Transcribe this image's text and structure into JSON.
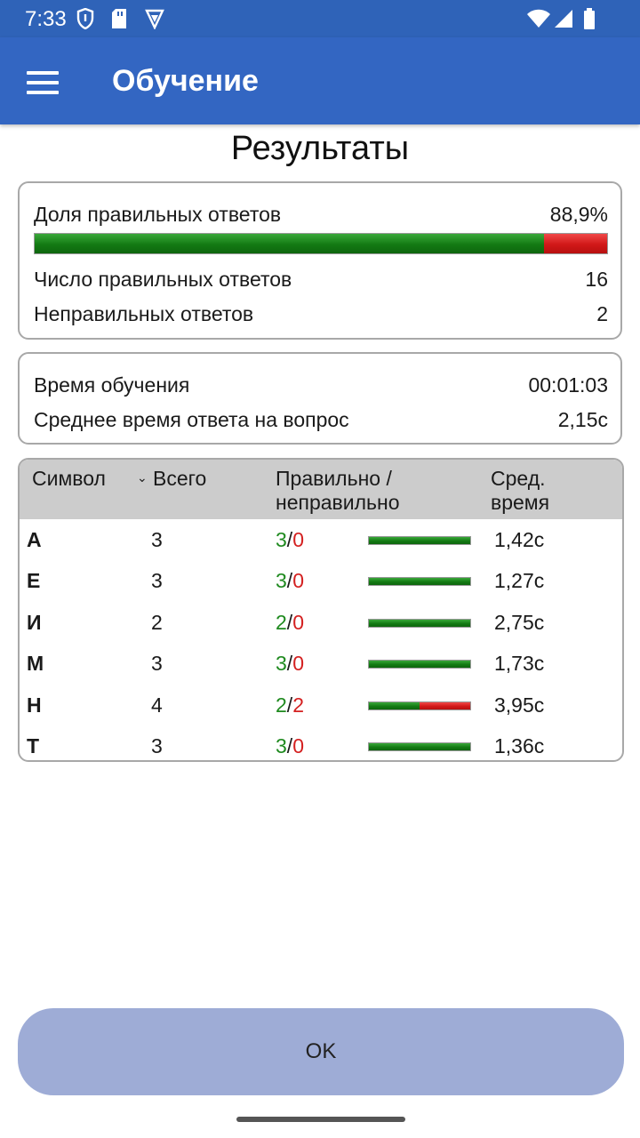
{
  "status": {
    "time": "7:33"
  },
  "app": {
    "title": "Обучение"
  },
  "page": {
    "title": "Результаты"
  },
  "summary": {
    "share_label": "Доля правильных ответов",
    "share_value": "88,9%",
    "share_fraction": 0.889,
    "correct_label": "Число правильных ответов",
    "correct_value": "16",
    "wrong_label": "Неправильных ответов",
    "wrong_value": "2"
  },
  "timing": {
    "time_label": "Время обучения",
    "time_value": "00:01:03",
    "avg_label": "Среднее время ответа на вопрос",
    "avg_value": "2,15с"
  },
  "table": {
    "headers": {
      "symbol": "Символ",
      "total": "Всего",
      "ratio_line1": "Правильно /",
      "ratio_line2": "неправильно",
      "avg_line1": "Сред.",
      "avg_line2": "время"
    },
    "sort_icon": "chevron-down-icon",
    "rows": [
      {
        "symbol": "А",
        "total": "3",
        "correct": "3",
        "wrong": "0",
        "avg": "1,42с",
        "fraction": 1.0
      },
      {
        "symbol": "Е",
        "total": "3",
        "correct": "3",
        "wrong": "0",
        "avg": "1,27с",
        "fraction": 1.0
      },
      {
        "symbol": "И",
        "total": "2",
        "correct": "2",
        "wrong": "0",
        "avg": "2,75с",
        "fraction": 1.0
      },
      {
        "symbol": "М",
        "total": "3",
        "correct": "3",
        "wrong": "0",
        "avg": "1,73с",
        "fraction": 1.0
      },
      {
        "symbol": "Н",
        "total": "4",
        "correct": "2",
        "wrong": "2",
        "avg": "3,95с",
        "fraction": 0.5
      },
      {
        "symbol": "Т",
        "total": "3",
        "correct": "3",
        "wrong": "0",
        "avg": "1,36с",
        "fraction": 1.0
      }
    ]
  },
  "ok_button": {
    "label": "OK"
  },
  "colors": {
    "correct": "#1f8a1f",
    "wrong": "#d42020",
    "appbar": "#3366c2",
    "button": "#9eacd6"
  }
}
